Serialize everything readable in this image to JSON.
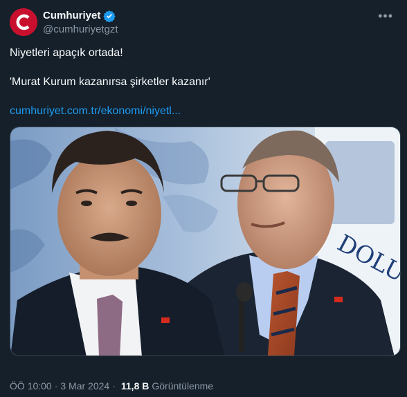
{
  "account": {
    "display_name": "Cumhuriyet",
    "handle": "@cumhuriyetgzt",
    "verified": true,
    "avatar_letter": "C",
    "brand_color": "#c8102e"
  },
  "tweet": {
    "line1": "Niyetleri apaçık ortada!",
    "line2": "'Murat Kurum kazanırsa şirketler kazanır'",
    "link": "cumhuriyet.com.tr/ekonomi/niyetl..."
  },
  "media": {
    "watermark_text": "DOLU"
  },
  "meta": {
    "time": "ÖÖ 10:00",
    "date": "3 Mar 2024",
    "views_count": "11,8 B",
    "views_label": "Görüntülenme"
  },
  "icons": {
    "more": "more-options-icon",
    "verified": "verified-badge-icon"
  },
  "colors": {
    "background": "#15202b",
    "link": "#1d9bf0",
    "secondary_text": "#8b98a5",
    "verified": "#1d9bf0"
  }
}
